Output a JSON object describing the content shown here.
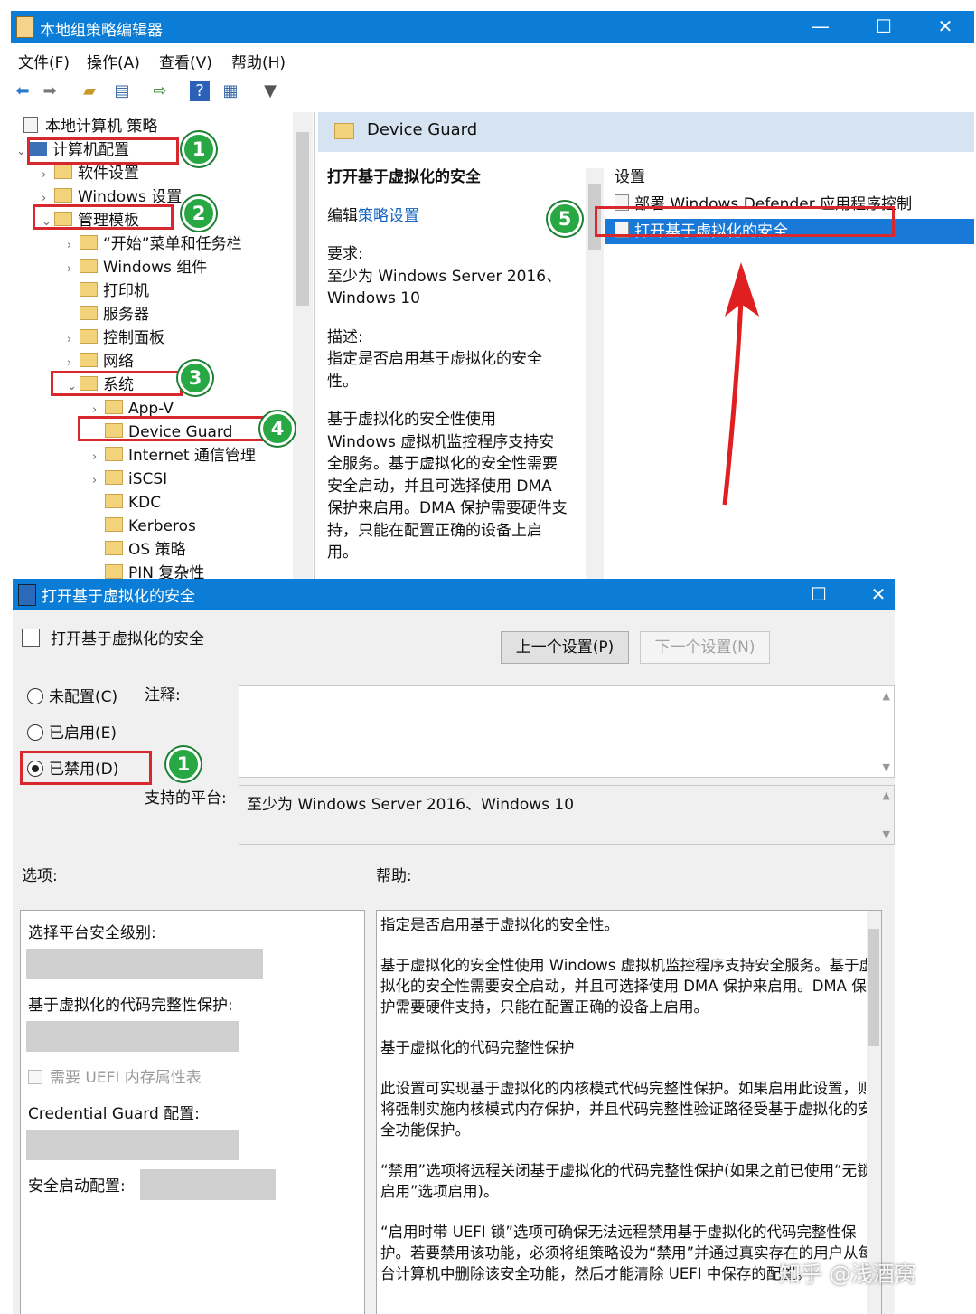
{
  "main_window": {
    "title": "本地组策略编辑器",
    "controls": {
      "minimize": "—",
      "maximize": "☐",
      "close": "✕"
    },
    "menu": [
      "文件(F)",
      "操作(A)",
      "查看(V)",
      "帮助(H)"
    ],
    "toolbar_icons": [
      "back-icon",
      "forward-icon",
      "up-folder-icon",
      "show-hide-tree-icon",
      "export-icon",
      "help-icon",
      "properties-icon",
      "filter-icon"
    ],
    "tree": {
      "root": "本地计算机 策略",
      "computer_config": "计算机配置",
      "software_settings": "软件设置",
      "windows_settings": "Windows 设置",
      "admin_templates": "管理模板",
      "start_menu": "“开始”菜单和任务栏",
      "windows_components": "Windows 组件",
      "printers": "打印机",
      "servers": "服务器",
      "control_panel": "控制面板",
      "network": "网络",
      "system": "系统",
      "app_v": "App-V",
      "device_guard": "Device Guard",
      "internet_comm": "Internet 通信管理",
      "iscsi": "iSCSI",
      "kdc": "KDC",
      "kerberos": "Kerberos",
      "os_policy": "OS 策略",
      "pin": "PIN 复杂性"
    },
    "right_panel": {
      "header": "Device Guard",
      "desc_title": "打开基于虚拟化的安全",
      "edit_prefix": "编辑",
      "edit_link": "策略设置",
      "req_label": "要求:",
      "req_text": "至少为 Windows Server 2016、Windows 10",
      "desc_label": "描述:",
      "desc_text": "指定是否启用基于虚拟化的安全性。",
      "desc_more": "基于虚拟化的安全性使用 Windows 虚拟机监控程序支持安全服务。基于虚拟化的安全性需要安全启动，并且可选择使用 DMA 保护来启用。DMA 保护需要硬件支持，只能在配置正确的设备上启用。",
      "list_header": "设置",
      "list_items": [
        "部署 Windows Defender 应用程序控制",
        "打开基于虚拟化的安全"
      ]
    },
    "callouts": [
      "1",
      "2",
      "3",
      "4",
      "5"
    ]
  },
  "dialog": {
    "title": "打开基于虚拟化的安全",
    "controls": {
      "maximize": "☐",
      "close": "✕"
    },
    "heading": "打开基于虚拟化的安全",
    "prev_button": "上一个设置(P)",
    "next_button": "下一个设置(N)",
    "radios": [
      "未配置(C)",
      "已启用(E)",
      "已禁用(D)"
    ],
    "selected_radio": "已禁用(D)",
    "comment_label": "注释:",
    "platform_label": "支持的平台:",
    "platform_value": "至少为 Windows Server 2016、Windows 10",
    "options_label": "选项:",
    "help_label": "帮助:",
    "options": {
      "platform_level": "选择平台安全级别:",
      "code_integrity": "基于虚拟化的代码完整性保护:",
      "uefi_checkbox": "需要 UEFI 内存属性表",
      "credential_guard": "Credential Guard 配置:",
      "secure_launch": "安全启动配置:"
    },
    "help_paragraphs": [
      "指定是否启用基于虚拟化的安全性。",
      "基于虚拟化的安全性使用 Windows 虚拟机监控程序支持安全服务。基于虚拟化的安全性需要安全启动，并且可选择使用 DMA 保护来启用。DMA 保护需要硬件支持，只能在配置正确的设备上启用。",
      "基于虚拟化的代码完整性保护",
      "此设置可实现基于虚拟化的内核模式代码完整性保护。如果启用此设置，则将强制实施内核模式内存保护，并且代码完整性验证路径受基于虚拟化的安全功能保护。",
      "“禁用”选项将远程关闭基于虚拟化的代码完整性保护(如果之前已使用“无锁启用”选项启用)。",
      "“启用时带 UEFI 锁”选项可确保无法远程禁用基于虚拟化的代码完整性保护。若要禁用该功能，必须将组策略设为“禁用”并通过真实存在的用户从每台计算机中删除该安全功能，然后才能清除 UEFI 中保存的配置。"
    ],
    "callout": "1"
  },
  "watermark": "知乎 @浅酒窝",
  "colors": {
    "titlebar": "#0b7dd6",
    "selection": "#1979d8",
    "callout_red": "#d9272e",
    "badge_green": "#27a843"
  }
}
